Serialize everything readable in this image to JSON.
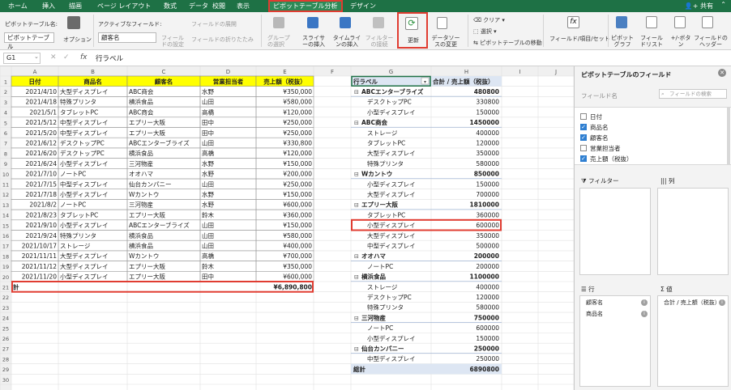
{
  "tabs": [
    "ホーム",
    "挿入",
    "描画",
    "ページ レイアウト",
    "数式",
    "データ",
    "校閲",
    "表示",
    "ピボットテーブル分析",
    "デザイン"
  ],
  "share_label": "共有",
  "ribbon": {
    "pivot_name_label": "ピボットテーブル名:",
    "pivot_name_value": "ピボットテーブル",
    "options_label": "オプション",
    "active_field_label": "アクティブなフィールド:",
    "active_field_value": "顧客名",
    "field_settings_label": "フィールドの設定",
    "expand_field_label": "フィールドの展開",
    "collapse_field_label": "フィールドの折りたたみ",
    "group_label": "グループの選択",
    "slicer_label": "スライサーの挿入",
    "timeline_label": "タイムラインの挿入",
    "filter_connect_label": "フィルターの接続",
    "refresh_label": "更新",
    "data_source_label": "データソースの変更",
    "clear_label": "クリア",
    "select_label": "選択",
    "move_label": "ピボットテーブルの移動",
    "fields_items_label": "フィールド/項目/セット",
    "pivot_chart_label": "ピボットグラフ",
    "field_list_label": "フィールドリスト",
    "plusminus_label": "+/-ボタン",
    "field_headers_label": "フィールドのヘッダー"
  },
  "formula_bar": {
    "name_box": "G1",
    "fx": "fx",
    "content": "行ラベル"
  },
  "columns": [
    "A",
    "B",
    "C",
    "D",
    "E",
    "F",
    "G",
    "H",
    "I",
    "J"
  ],
  "table": {
    "headers": [
      "日付",
      "商品名",
      "顧客名",
      "営業担当者",
      "売上額（税抜）"
    ],
    "rows": [
      [
        "2021/4/10",
        "大型ディスプレイ",
        "ABC商会",
        "水野",
        "¥350,000"
      ],
      [
        "2021/4/18",
        "特殊プリンタ",
        "横浜食品",
        "山田",
        "¥580,000"
      ],
      [
        "2021/5/1",
        "タブレットPC",
        "ABC商会",
        "高橋",
        "¥120,000"
      ],
      [
        "2021/5/12",
        "中型ディスプレイ",
        "エプリー大阪",
        "田中",
        "¥250,000"
      ],
      [
        "2021/5/20",
        "中型ディスプレイ",
        "エプリー大阪",
        "田中",
        "¥250,000"
      ],
      [
        "2021/6/12",
        "デスクトップPC",
        "ABCエンターブライズ",
        "山田",
        "¥330,800"
      ],
      [
        "2021/6/20",
        "デスクトップPC",
        "横浜食品",
        "高橋",
        "¥120,000"
      ],
      [
        "2021/6/24",
        "小型ディスプレイ",
        "三河物産",
        "水野",
        "¥150,000"
      ],
      [
        "2021/7/10",
        "ノートPC",
        "オオハマ",
        "水野",
        "¥200,000"
      ],
      [
        "2021/7/15",
        "中型ディスプレイ",
        "仙台カンパニー",
        "山田",
        "¥250,000"
      ],
      [
        "2021/7/18",
        "小型ディスプレイ",
        "Wカントウ",
        "水野",
        "¥150,000"
      ],
      [
        "2021/8/2",
        "ノートPC",
        "三河物産",
        "水野",
        "¥600,000"
      ],
      [
        "2021/8/23",
        "タブレットPC",
        "エプリー大阪",
        "鈴木",
        "¥360,000"
      ],
      [
        "2021/9/10",
        "小型ディスプレイ",
        "ABCエンターブライズ",
        "山田",
        "¥150,000"
      ],
      [
        "2021/9/24",
        "特殊プリンタ",
        "横浜食品",
        "山田",
        "¥580,000"
      ],
      [
        "2021/10/17",
        "ストレージ",
        "横浜食品",
        "山田",
        "¥400,000"
      ],
      [
        "2021/11/11",
        "大型ディスプレイ",
        "Wカントウ",
        "高橋",
        "¥700,000"
      ],
      [
        "2021/11/12",
        "大型ディスプレイ",
        "エプリー大阪",
        "鈴木",
        "¥350,000"
      ],
      [
        "2021/11/20",
        "小型ディスプレイ",
        "エプリー大阪",
        "田中",
        "¥600,000"
      ]
    ],
    "total_label": "計",
    "total_value": "¥6,890,800"
  },
  "pivot": {
    "header_label": "行ラベル",
    "header_value": "合計 / 売上額（税抜）",
    "rows": [
      {
        "label": "ABCエンターブライズ",
        "value": "480800",
        "group": true
      },
      {
        "label": "デスクトップPC",
        "value": "330800",
        "group": false
      },
      {
        "label": "小型ディスプレイ",
        "value": "150000",
        "group": false
      },
      {
        "label": "ABC商会",
        "value": "1450000",
        "group": true
      },
      {
        "label": "ストレージ",
        "value": "400000",
        "group": false
      },
      {
        "label": "タブレットPC",
        "value": "120000",
        "group": false
      },
      {
        "label": "大型ディスプレイ",
        "value": "350000",
        "group": false
      },
      {
        "label": "特殊プリンタ",
        "value": "580000",
        "group": false
      },
      {
        "label": "Wカントウ",
        "value": "850000",
        "group": true
      },
      {
        "label": "小型ディスプレイ",
        "value": "150000",
        "group": false
      },
      {
        "label": "大型ディスプレイ",
        "value": "700000",
        "group": false
      },
      {
        "label": "エプリー大阪",
        "value": "1810000",
        "group": true
      },
      {
        "label": "タブレットPC",
        "value": "360000",
        "group": false
      },
      {
        "label": "小型ディスプレイ",
        "value": "600000",
        "group": false
      },
      {
        "label": "大型ディスプレイ",
        "value": "350000",
        "group": false
      },
      {
        "label": "中型ディスプレイ",
        "value": "500000",
        "group": false
      },
      {
        "label": "オオハマ",
        "value": "200000",
        "group": true
      },
      {
        "label": "ノートPC",
        "value": "200000",
        "group": false
      },
      {
        "label": "横浜食品",
        "value": "1100000",
        "group": true
      },
      {
        "label": "ストレージ",
        "value": "400000",
        "group": false
      },
      {
        "label": "デスクトップPC",
        "value": "120000",
        "group": false
      },
      {
        "label": "特殊プリンタ",
        "value": "580000",
        "group": false
      },
      {
        "label": "三河物産",
        "value": "750000",
        "group": true
      },
      {
        "label": "ノートPC",
        "value": "600000",
        "group": false
      },
      {
        "label": "小型ディスプレイ",
        "value": "150000",
        "group": false
      },
      {
        "label": "仙台カンパニー",
        "value": "250000",
        "group": true
      },
      {
        "label": "中型ディスプレイ",
        "value": "250000",
        "group": false
      }
    ],
    "total_label": "総計",
    "total_value": "6890800"
  },
  "pane": {
    "title": "ピボットテーブルのフィールド",
    "field_name_label": "フィールド名",
    "search_placeholder": "フィールドの検索",
    "fields": [
      {
        "label": "日付",
        "checked": false
      },
      {
        "label": "商品名",
        "checked": true
      },
      {
        "label": "顧客名",
        "checked": true
      },
      {
        "label": "営業担当者",
        "checked": false
      },
      {
        "label": "売上額（税抜）",
        "checked": true
      }
    ],
    "filter_label": "フィルター",
    "columns_label": "列",
    "rows_label": "行",
    "values_label": "値",
    "rows_items": [
      "顧客名",
      "商品名"
    ],
    "values_items": [
      "合計 / 売上額（税抜）"
    ]
  },
  "colors": {
    "excel_green": "#1e7145",
    "highlight_red": "#e03c31",
    "header_yellow": "#ffff00",
    "pivot_blue": "#dde6f3"
  }
}
